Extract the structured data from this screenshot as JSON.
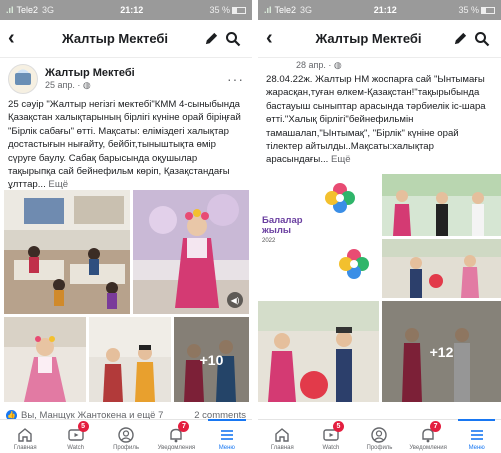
{
  "left": {
    "status": {
      "carrier": "Tele2",
      "network": "3G",
      "time": "21:12",
      "battery": "35 %"
    },
    "nav": {
      "title": "Жалтыр Мектебі",
      "back_icon": "chevron-left-icon",
      "edit_icon": "pencil-icon",
      "search_icon": "search-icon"
    },
    "post": {
      "author": "Жалтыр Мектебі",
      "date": "25 апр. · ",
      "privacy_icon": "globe-icon",
      "text": "25 сәуір \"Жалтыр негізгі мектебі\"КММ 4-сыныбында Қазақстан халықтарының бірлігі күніне орай біріңғай \"Бірлік сабағы\" өтті. Мақсаты: еліміздегі халықтар достастығын нығайту, бейбіт,тыныштықта өмір сүруге баулу. Сабақ барысында оқушылар тақырыпқа сай бейнефильм көріп, Қазақстандағы ұлттар...",
      "more": "Ещё",
      "photos_more": "+10",
      "reactions": "Вы, Манщук Жантокена и ещё 7",
      "comments": "2 comments"
    },
    "tabs": [
      {
        "label": "Главная",
        "icon": "home-icon",
        "badge": ""
      },
      {
        "label": "Watch",
        "icon": "watch-icon",
        "badge": "5"
      },
      {
        "label": "Профиль",
        "icon": "profile-icon",
        "badge": ""
      },
      {
        "label": "Уведомления",
        "icon": "bell-icon",
        "badge": "7"
      },
      {
        "label": "Меню",
        "icon": "menu-icon",
        "badge": ""
      }
    ]
  },
  "right": {
    "status": {
      "carrier": "Tele2",
      "network": "3G",
      "time": "21:12",
      "battery": "35 %"
    },
    "nav": {
      "title": "Жалтыр Мектебі",
      "back_icon": "chevron-left-icon",
      "edit_icon": "pencil-icon",
      "search_icon": "search-icon"
    },
    "post": {
      "date": "28 апр. · ",
      "privacy_icon": "globe-icon",
      "text": "28.04.22ж. Жалтыр НМ жоспарға сай \"Ынтымағы жарасқан,туған өлкем-Қазақстан!\"тақырыбында бастауыш сыныптар арасында тәрбиелік іс-шара өтті.\"Халық бірлігі\"бейнефильмін тамашалап,\"Ынтымақ\", \"Бірлік\" күніне орай тілектер айтылды..Мақсаты:халықтар арасындағы...",
      "more": "Ещё",
      "banner_text": "Балалар жылы",
      "banner_year": "2022",
      "photos_more": "+12"
    },
    "tabs": [
      {
        "label": "Главная",
        "icon": "home-icon",
        "badge": ""
      },
      {
        "label": "Watch",
        "icon": "watch-icon",
        "badge": "5"
      },
      {
        "label": "Профиль",
        "icon": "profile-icon",
        "badge": ""
      },
      {
        "label": "Уведомления",
        "icon": "bell-icon",
        "badge": "7"
      },
      {
        "label": "Меню",
        "icon": "menu-icon",
        "badge": ""
      }
    ]
  },
  "colors": {
    "accent": "#1877f2",
    "badge": "#e41e3f",
    "status_bar": "#9a9a9a"
  }
}
